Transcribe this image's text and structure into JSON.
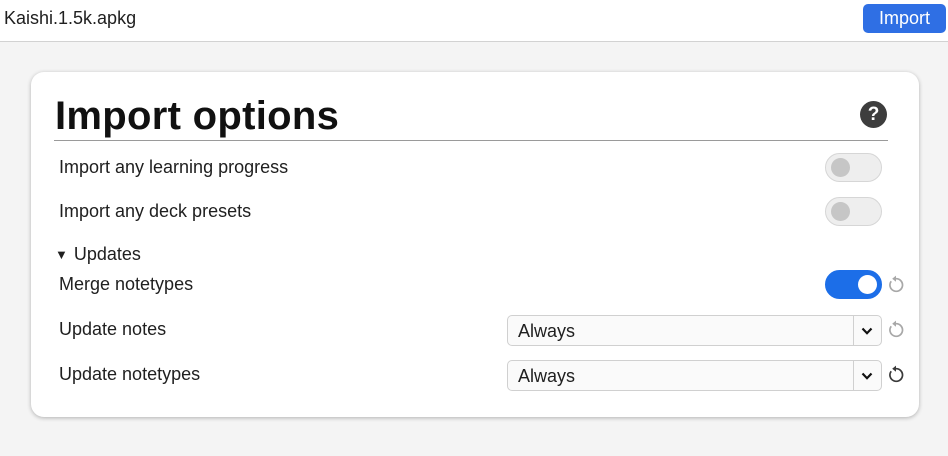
{
  "header": {
    "filename": "Kaishi.1.5k.apkg",
    "import_label": "Import"
  },
  "card": {
    "title": "Import options",
    "help_icon": "?",
    "options": [
      {
        "label": "Import any learning progress",
        "enabled": false
      },
      {
        "label": "Import any deck presets",
        "enabled": false
      }
    ],
    "updates": {
      "section_label": "Updates",
      "expanded": true,
      "merge_notetypes": {
        "label": "Merge notetypes",
        "enabled": true
      },
      "update_notes": {
        "label": "Update notes",
        "value": "Always"
      },
      "update_notetypes": {
        "label": "Update notetypes",
        "value": "Always"
      }
    }
  },
  "colors": {
    "accent": "#1c6ee8",
    "import_button": "#2f6fe4",
    "help_icon_bg": "#3d3d3d"
  },
  "icons": {
    "help": "help-icon",
    "revert": "revert-icon",
    "dropdown": "chevron-down-icon",
    "section_expanded": "triangle-down-icon"
  }
}
